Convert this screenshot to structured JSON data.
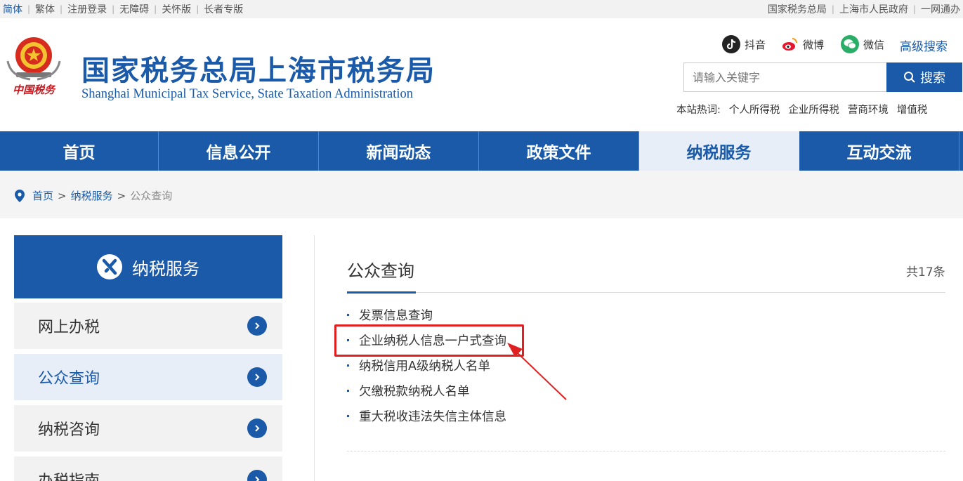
{
  "topbar": {
    "left_links": [
      {
        "label": "简体",
        "active": true
      },
      {
        "label": "繁体",
        "active": false
      },
      {
        "label": "注册登录",
        "active": false
      },
      {
        "label": "无障碍",
        "active": false
      },
      {
        "label": "关怀版",
        "active": false
      },
      {
        "label": "长者专版",
        "active": false
      }
    ],
    "right_links": [
      "国家税务总局",
      "上海市人民政府",
      "一网通办"
    ]
  },
  "header": {
    "emblem_text": "中国税务",
    "title": "国家税务总局上海市税务局",
    "subtitle": "Shanghai Municipal Tax Service, State Taxation Administration",
    "social": [
      {
        "label": "抖音",
        "icon": "douyin-icon",
        "color": "#222222"
      },
      {
        "label": "微博",
        "icon": "weibo-icon",
        "color": "#e6162d"
      },
      {
        "label": "微信",
        "icon": "wechat-icon",
        "color": "#2aae67"
      }
    ],
    "advanced_search": "高级搜索",
    "search": {
      "placeholder": "请输入关键字",
      "button": "搜索"
    },
    "hot": {
      "label": "本站热词:",
      "items": [
        "个人所得税",
        "企业所得税",
        "营商环境",
        "增值税"
      ]
    }
  },
  "nav": {
    "items": [
      {
        "label": "首页",
        "active": false
      },
      {
        "label": "信息公开",
        "active": false
      },
      {
        "label": "新闻动态",
        "active": false
      },
      {
        "label": "政策文件",
        "active": false
      },
      {
        "label": "纳税服务",
        "active": true
      },
      {
        "label": "互动交流",
        "active": false
      }
    ]
  },
  "breadcrumb": {
    "items": [
      "首页",
      "纳税服务"
    ],
    "current": "公众查询",
    "separator": ">"
  },
  "sidebar": {
    "title": "纳税服务",
    "items": [
      {
        "label": "网上办税",
        "active": false
      },
      {
        "label": "公众查询",
        "active": true
      },
      {
        "label": "纳税咨询",
        "active": false
      },
      {
        "label": "办税指南",
        "active": false
      }
    ]
  },
  "content": {
    "title": "公众查询",
    "count": "共17条",
    "items": [
      "发票信息查询",
      "企业纳税人信息一户式查询",
      "纳税信用A级纳税人名单",
      "欠缴税款纳税人名单",
      "重大税收违法失信主体信息"
    ]
  },
  "colors": {
    "brand": "#1a5aa8",
    "annotation": "#e02020"
  }
}
